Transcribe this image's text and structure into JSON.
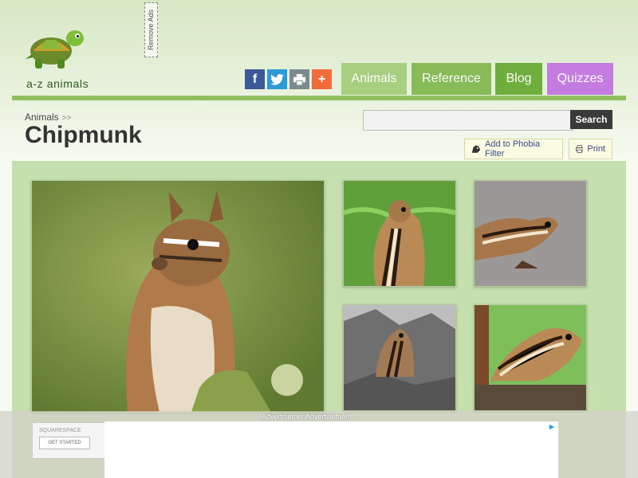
{
  "site": {
    "name": "a-z animals",
    "remove_ads": "Remove Ads"
  },
  "share_icons": [
    {
      "icon": "facebook-icon",
      "glyph": "f",
      "color": "#3b5998"
    },
    {
      "icon": "twitter-icon",
      "glyph": "",
      "color": "#2c9ad4"
    },
    {
      "icon": "print-share-icon",
      "glyph": "",
      "color": "#7d8a8e"
    },
    {
      "icon": "plus-icon",
      "glyph": "+",
      "color": "#f26b3a"
    }
  ],
  "nav": {
    "animals": "Animals",
    "reference": "Reference",
    "blog": "Blog",
    "quizzes": "Quizzes",
    "colors": {
      "animals": "#a7cf7f",
      "reference": "#86bb57",
      "blog": "#6fae3c",
      "quizzes": "#c57ce0"
    }
  },
  "breadcrumb": {
    "item": "Animals",
    "separator": ">>"
  },
  "page_title": "Chipmunk",
  "search": {
    "placeholder": "",
    "button": "Search"
  },
  "tools": {
    "phobia": "Add to Phobia Filter",
    "print": "Print"
  },
  "ad": {
    "label1": "Advertisement",
    "label2": "Advertisement",
    "squarespace": "SQUARESPACE",
    "cta": "GET STARTED"
  }
}
